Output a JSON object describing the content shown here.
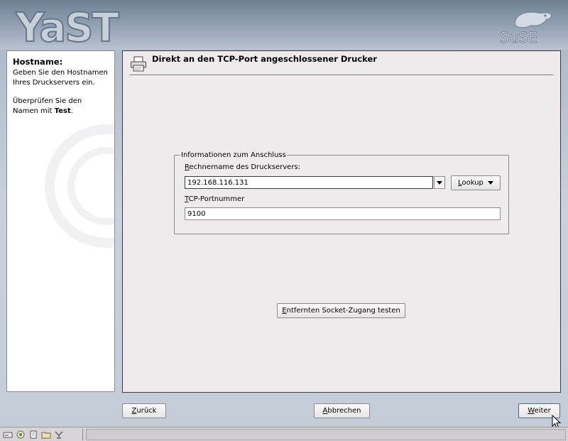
{
  "branding": {
    "app_logo": "YaST",
    "vendor_logo": "SuSE"
  },
  "help": {
    "title": "Hostname:",
    "paragraph1": "Geben Sie den Hostnamen Ihres Druckservers ein.",
    "paragraph2_prefix": "Überprüfen Sie den Namen mit ",
    "paragraph2_bold": "Test",
    "paragraph2_suffix": "."
  },
  "main": {
    "title": "Direkt an den TCP-Port angeschlossener Drucker",
    "group": {
      "legend": "Informationen zum Anschluss",
      "hostname_label_mnemonic": "R",
      "hostname_label_rest": "echnername des Druckservers:",
      "hostname_value": "192.168.116.131",
      "lookup_mnemonic": "L",
      "lookup_rest": "ookup",
      "port_label_mnemonic": "T",
      "port_label_rest": "CP-Portnummer",
      "port_value": "9100"
    },
    "test_button": {
      "mnemonic": "E",
      "rest": "ntfernten Socket-Zugang testen"
    }
  },
  "footer": {
    "back": {
      "mnemonic": "Z",
      "rest": "urück"
    },
    "abort": {
      "mnemonic": "A",
      "rest": "bbrechen"
    },
    "next": {
      "mnemonic": "W",
      "rest": "eiter"
    }
  },
  "icons": {
    "printer": "printer-icon",
    "combo": "chevron-down-icon",
    "cursor": "mouse-cursor-icon",
    "taskbar": [
      "drive-icon",
      "settings-icon",
      "document-icon",
      "folder-icon",
      "network-icon"
    ]
  },
  "colors": {
    "banner": "#7f91a5",
    "panel": "#efebed",
    "focus_border": "#2c3a4a"
  }
}
